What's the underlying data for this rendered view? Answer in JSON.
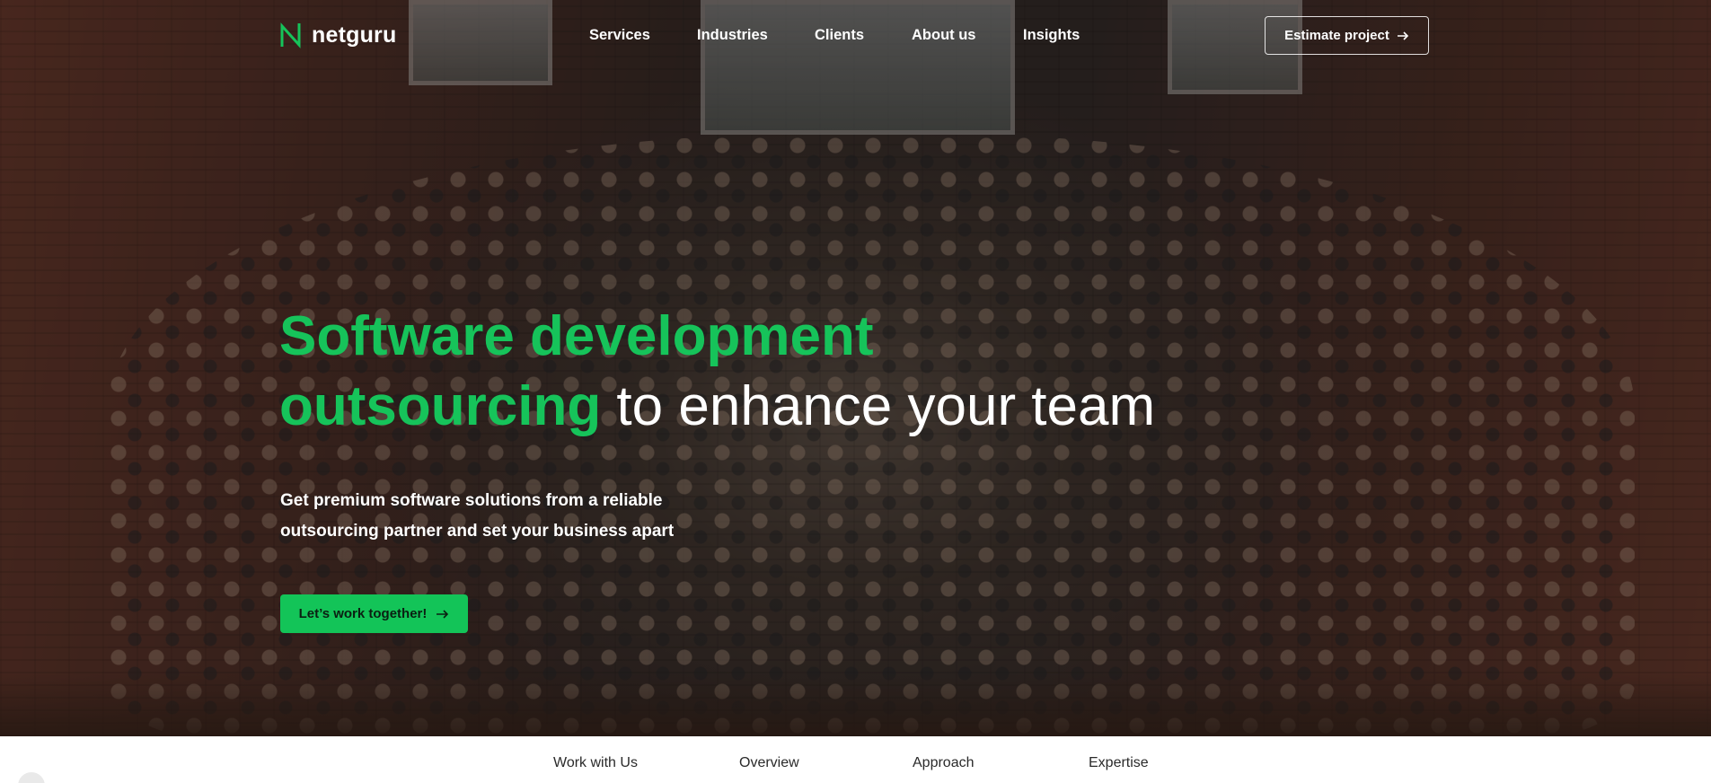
{
  "brand": {
    "logo_text": "netguru",
    "accent_color": "#16c35a"
  },
  "nav": {
    "items": [
      {
        "label": "Services"
      },
      {
        "label": "Industries"
      },
      {
        "label": "Clients"
      },
      {
        "label": "About us"
      },
      {
        "label": "Insights"
      }
    ],
    "estimate_label": "Estimate project"
  },
  "hero": {
    "headline_green_1": "Software development",
    "headline_green_2": "outsourcing",
    "headline_white": " to enhance your team",
    "subtitle_line_1": "Get premium software solutions from a reliable",
    "subtitle_line_2": "outsourcing partner and set your business apart",
    "cta_label": "Let’s work together!",
    "background_icon": "team-photo"
  },
  "subnav": {
    "items": [
      {
        "label": "Work with Us"
      },
      {
        "label": "Overview"
      },
      {
        "label": "Approach"
      },
      {
        "label": "Expertise"
      }
    ]
  }
}
